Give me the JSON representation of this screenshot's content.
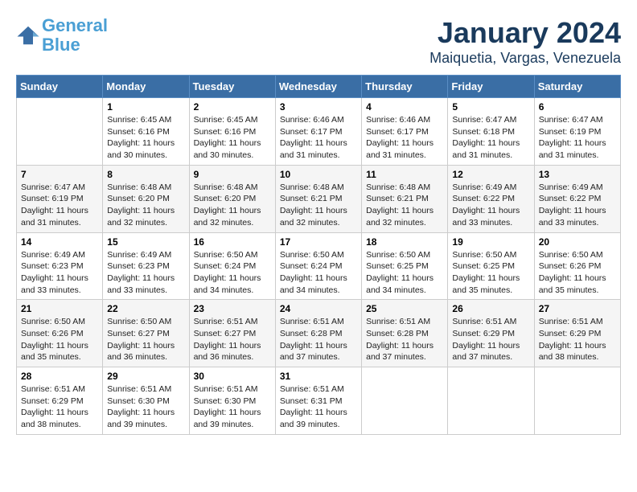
{
  "logo": {
    "line1": "General",
    "line2": "Blue"
  },
  "title": "January 2024",
  "subtitle": "Maiquetia, Vargas, Venezuela",
  "weekdays": [
    "Sunday",
    "Monday",
    "Tuesday",
    "Wednesday",
    "Thursday",
    "Friday",
    "Saturday"
  ],
  "weeks": [
    [
      {
        "day": "",
        "info": ""
      },
      {
        "day": "1",
        "info": "Sunrise: 6:45 AM\nSunset: 6:16 PM\nDaylight: 11 hours\nand 30 minutes."
      },
      {
        "day": "2",
        "info": "Sunrise: 6:45 AM\nSunset: 6:16 PM\nDaylight: 11 hours\nand 30 minutes."
      },
      {
        "day": "3",
        "info": "Sunrise: 6:46 AM\nSunset: 6:17 PM\nDaylight: 11 hours\nand 31 minutes."
      },
      {
        "day": "4",
        "info": "Sunrise: 6:46 AM\nSunset: 6:17 PM\nDaylight: 11 hours\nand 31 minutes."
      },
      {
        "day": "5",
        "info": "Sunrise: 6:47 AM\nSunset: 6:18 PM\nDaylight: 11 hours\nand 31 minutes."
      },
      {
        "day": "6",
        "info": "Sunrise: 6:47 AM\nSunset: 6:19 PM\nDaylight: 11 hours\nand 31 minutes."
      }
    ],
    [
      {
        "day": "7",
        "info": "Sunrise: 6:47 AM\nSunset: 6:19 PM\nDaylight: 11 hours\nand 31 minutes."
      },
      {
        "day": "8",
        "info": "Sunrise: 6:48 AM\nSunset: 6:20 PM\nDaylight: 11 hours\nand 32 minutes."
      },
      {
        "day": "9",
        "info": "Sunrise: 6:48 AM\nSunset: 6:20 PM\nDaylight: 11 hours\nand 32 minutes."
      },
      {
        "day": "10",
        "info": "Sunrise: 6:48 AM\nSunset: 6:21 PM\nDaylight: 11 hours\nand 32 minutes."
      },
      {
        "day": "11",
        "info": "Sunrise: 6:48 AM\nSunset: 6:21 PM\nDaylight: 11 hours\nand 32 minutes."
      },
      {
        "day": "12",
        "info": "Sunrise: 6:49 AM\nSunset: 6:22 PM\nDaylight: 11 hours\nand 33 minutes."
      },
      {
        "day": "13",
        "info": "Sunrise: 6:49 AM\nSunset: 6:22 PM\nDaylight: 11 hours\nand 33 minutes."
      }
    ],
    [
      {
        "day": "14",
        "info": "Sunrise: 6:49 AM\nSunset: 6:23 PM\nDaylight: 11 hours\nand 33 minutes."
      },
      {
        "day": "15",
        "info": "Sunrise: 6:49 AM\nSunset: 6:23 PM\nDaylight: 11 hours\nand 33 minutes."
      },
      {
        "day": "16",
        "info": "Sunrise: 6:50 AM\nSunset: 6:24 PM\nDaylight: 11 hours\nand 34 minutes."
      },
      {
        "day": "17",
        "info": "Sunrise: 6:50 AM\nSunset: 6:24 PM\nDaylight: 11 hours\nand 34 minutes."
      },
      {
        "day": "18",
        "info": "Sunrise: 6:50 AM\nSunset: 6:25 PM\nDaylight: 11 hours\nand 34 minutes."
      },
      {
        "day": "19",
        "info": "Sunrise: 6:50 AM\nSunset: 6:25 PM\nDaylight: 11 hours\nand 35 minutes."
      },
      {
        "day": "20",
        "info": "Sunrise: 6:50 AM\nSunset: 6:26 PM\nDaylight: 11 hours\nand 35 minutes."
      }
    ],
    [
      {
        "day": "21",
        "info": "Sunrise: 6:50 AM\nSunset: 6:26 PM\nDaylight: 11 hours\nand 35 minutes."
      },
      {
        "day": "22",
        "info": "Sunrise: 6:50 AM\nSunset: 6:27 PM\nDaylight: 11 hours\nand 36 minutes."
      },
      {
        "day": "23",
        "info": "Sunrise: 6:51 AM\nSunset: 6:27 PM\nDaylight: 11 hours\nand 36 minutes."
      },
      {
        "day": "24",
        "info": "Sunrise: 6:51 AM\nSunset: 6:28 PM\nDaylight: 11 hours\nand 37 minutes."
      },
      {
        "day": "25",
        "info": "Sunrise: 6:51 AM\nSunset: 6:28 PM\nDaylight: 11 hours\nand 37 minutes."
      },
      {
        "day": "26",
        "info": "Sunrise: 6:51 AM\nSunset: 6:29 PM\nDaylight: 11 hours\nand 37 minutes."
      },
      {
        "day": "27",
        "info": "Sunrise: 6:51 AM\nSunset: 6:29 PM\nDaylight: 11 hours\nand 38 minutes."
      }
    ],
    [
      {
        "day": "28",
        "info": "Sunrise: 6:51 AM\nSunset: 6:29 PM\nDaylight: 11 hours\nand 38 minutes."
      },
      {
        "day": "29",
        "info": "Sunrise: 6:51 AM\nSunset: 6:30 PM\nDaylight: 11 hours\nand 39 minutes."
      },
      {
        "day": "30",
        "info": "Sunrise: 6:51 AM\nSunset: 6:30 PM\nDaylight: 11 hours\nand 39 minutes."
      },
      {
        "day": "31",
        "info": "Sunrise: 6:51 AM\nSunset: 6:31 PM\nDaylight: 11 hours\nand 39 minutes."
      },
      {
        "day": "",
        "info": ""
      },
      {
        "day": "",
        "info": ""
      },
      {
        "day": "",
        "info": ""
      }
    ]
  ]
}
